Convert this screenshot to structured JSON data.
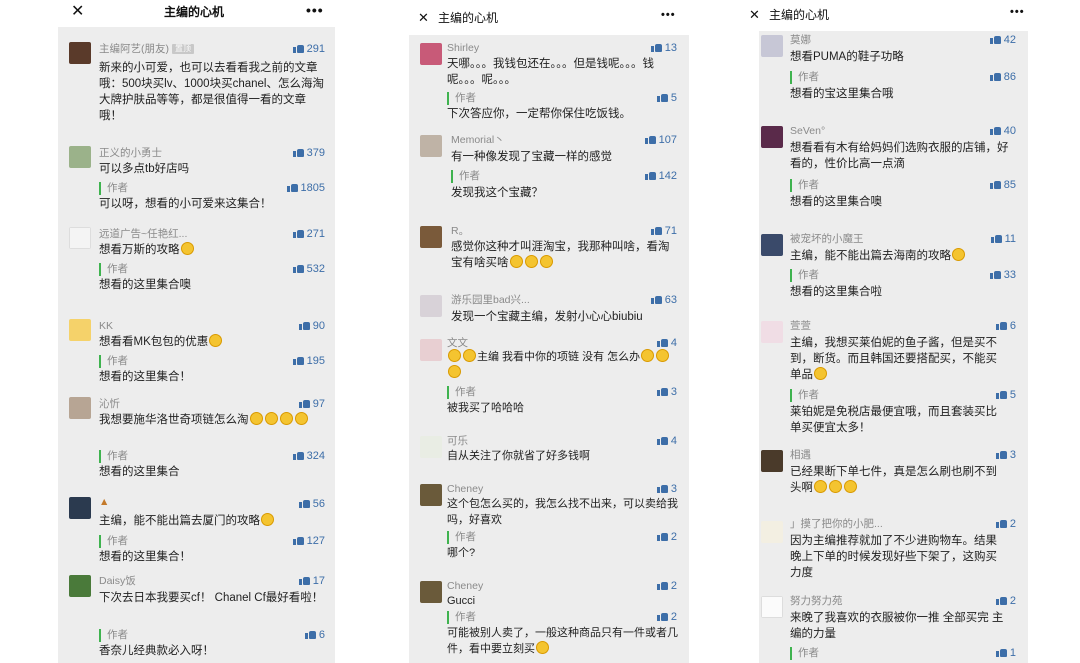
{
  "title": "主编的心机",
  "author_label": "作者",
  "friend_tag": "置顶",
  "colors": {
    "accent": "#3d6ea8",
    "author_bar": "#3fb34f",
    "bg": "#ededed"
  },
  "icons": {
    "close": "close-icon",
    "more": "more-icon",
    "like": "thumbs-up-icon"
  },
  "panels": [
    {
      "comments": [
        {
          "name": "主编阿艺(朋友)",
          "likes": "291",
          "text": "新来的小可爱，也可以去看看我之前的文章哦：500块买lv、1000块买chanel、怎么海淘大牌护肤品等等，都是很值得一看的文章哦！"
        },
        {
          "name": "正义的小勇士",
          "likes": "379",
          "text": "可以多点tb好店吗",
          "reply_likes": "1805",
          "reply": "可以呀，想看的小可爱来这集合！"
        },
        {
          "name": "远道广告~任艳红...",
          "likes": "271",
          "text": "想看万斯的攻略",
          "reply_likes": "532",
          "reply": "想看的这里集合噢"
        },
        {
          "name": "KK",
          "likes": "90",
          "text": "想看看MK包包的优惠",
          "reply_likes": "195",
          "reply": "想看的这里集合！"
        },
        {
          "name": "沁忻",
          "likes": "97",
          "text": "我想要施华洛世奇项链怎么淘",
          "reply_likes": "324",
          "reply": "想看的这里集合"
        },
        {
          "name": "",
          "likes": "56",
          "text": "主编，能不能出篇去厦门的攻略",
          "reply_likes": "127",
          "reply": "想看的这里集合！"
        },
        {
          "name": "Daisy饭",
          "likes": "17",
          "text": "下次去日本我要买cf！ Chanel Cf最好看啦！",
          "reply_likes": "6",
          "reply": "香奈儿经典款必入呀！"
        }
      ]
    },
    {
      "comments": [
        {
          "name": "Shirley",
          "likes": "13",
          "text": "天哪。。。我钱包还在。。。但是钱呢。。。钱呢。。。呢。。。",
          "reply_likes": "5",
          "reply": "下次答应你，一定帮你保住吃饭钱。"
        },
        {
          "name": "Memorial丶",
          "likes": "107",
          "text": "有一种像发现了宝藏一样的感觉",
          "reply_likes": "142",
          "reply": "发现我这个宝藏？"
        },
        {
          "name": "R。",
          "likes": "71",
          "text": "感觉你这种才叫涯淘宝，我那种叫啥，看淘宝有啥买啥"
        },
        {
          "name": "游乐园里bad兴...",
          "likes": "63",
          "text": "发现一个宝藏主编，发射小心心biubiu"
        },
        {
          "name": "文文",
          "likes": "4",
          "text": "主编 我看中你的项链 没有 怎么办",
          "reply_likes": "3",
          "reply": "被我买了哈哈哈"
        },
        {
          "name": "可乐",
          "likes": "4",
          "text": "自从关注了你就省了好多钱啊"
        },
        {
          "name": "Cheney",
          "likes": "3",
          "text": "这个包怎么买的，我怎么找不出来，可以卖给我吗，好喜欢",
          "reply_likes": "2",
          "reply": "哪个?"
        },
        {
          "name": "Cheney",
          "likes": "2",
          "text": "Gucci",
          "reply_likes": "2",
          "reply": "可能被别人卖了，一般这种商品只有一件或者几件，看中要立刻买"
        }
      ]
    },
    {
      "comments": [
        {
          "name": "莫娜",
          "likes": "42",
          "text": "想看PUMA的鞋子功略",
          "reply_likes": "86",
          "reply": "想看的宝这里集合哦"
        },
        {
          "name": "SeVen°",
          "likes": "40",
          "text": "想看看有木有给妈妈们选购衣服的店铺，好看的，性价比高一点滴",
          "reply_likes": "85",
          "reply": "想看的这里集合噢"
        },
        {
          "name": "被宠坏的小魔王",
          "likes": "11",
          "text": "主编，能不能出篇去海南的攻略",
          "reply_likes": "33",
          "reply": "想看的这里集合啦"
        },
        {
          "name": "萱萱",
          "likes": "6",
          "text": "主编，我想买莱伯妮的鱼子酱，但是买不到，断货。而且韩国还要搭配买，不能买单品",
          "reply_likes": "5",
          "reply": "莱铂妮是免税店最便宜哦，而且套装买比单买便宜太多！"
        },
        {
          "name": "相遇",
          "likes": "3",
          "text": "已经果断下单七件，真是怎么刷也刷不到头啊"
        },
        {
          "name": "」摸了把你的小肥...",
          "likes": "2",
          "text": "因为主编推荐就加了不少进购物车。结果晚上下单的时候发现好些下架了，这购买力度"
        },
        {
          "name": "努力努力苑",
          "likes": "2",
          "text": "来晚了我喜欢的衣服被你一推 全部买完 主编的力量",
          "reply_likes": "1",
          "reply": ""
        }
      ]
    }
  ]
}
